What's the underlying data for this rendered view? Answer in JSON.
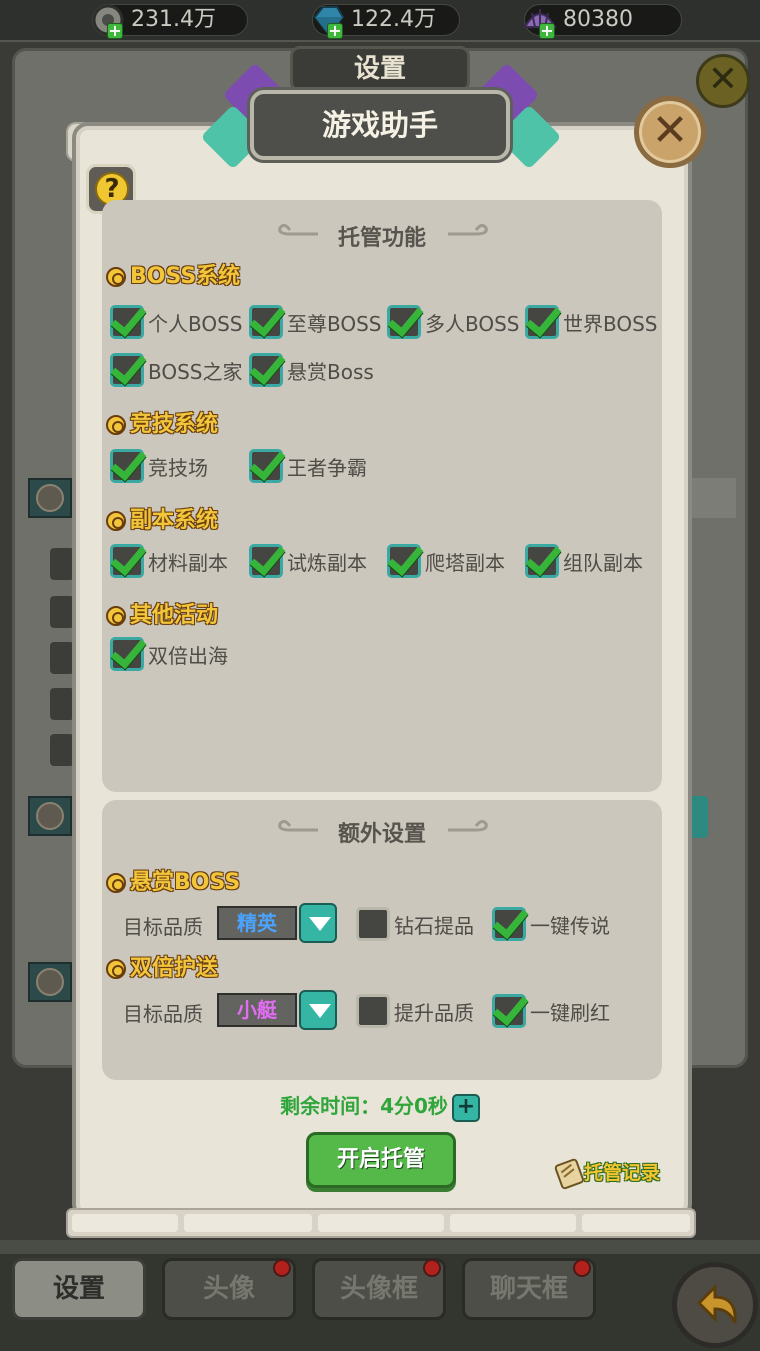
{
  "resources": [
    {
      "value": "231.4万",
      "icon": "coin-icon"
    },
    {
      "value": "122.4万",
      "icon": "gem-icon"
    },
    {
      "value": "80380",
      "icon": "shell-icon"
    }
  ],
  "bg": {
    "title": "设置"
  },
  "dialog": {
    "title": "游戏助手",
    "hosting": {
      "title": "托管功能",
      "categories": [
        {
          "name": "BOSS系统",
          "options": [
            {
              "label": "个人BOSS",
              "checked": true
            },
            {
              "label": "至尊BOSS",
              "checked": true
            },
            {
              "label": "多人BOSS",
              "checked": true
            },
            {
              "label": "世界BOSS",
              "checked": true
            },
            {
              "label": "BOSS之家",
              "checked": true
            },
            {
              "label": "悬赏Boss",
              "checked": true
            }
          ]
        },
        {
          "name": "竞技系统",
          "options": [
            {
              "label": "竞技场",
              "checked": true
            },
            {
              "label": "王者争霸",
              "checked": true
            }
          ]
        },
        {
          "name": "副本系统",
          "options": [
            {
              "label": "材料副本",
              "checked": true
            },
            {
              "label": "试炼副本",
              "checked": true
            },
            {
              "label": "爬塔副本",
              "checked": true
            },
            {
              "label": "组队副本",
              "checked": true
            }
          ]
        },
        {
          "name": "其他活动",
          "options": [
            {
              "label": "双倍出海",
              "checked": true
            }
          ]
        }
      ]
    },
    "extra": {
      "title": "额外设置",
      "bounty": {
        "name": "悬赏BOSS",
        "quality_label": "目标品质",
        "quality_value": "精英",
        "quality_color": "#4aa3ff",
        "opt1": {
          "label": "钻石提品",
          "checked": false
        },
        "opt2": {
          "label": "一键传说",
          "checked": true
        }
      },
      "escort": {
        "name": "双倍护送",
        "quality_label": "目标品质",
        "quality_value": "小艇",
        "quality_color": "#e36cf5",
        "opt1": {
          "label": "提升品质",
          "checked": false
        },
        "opt2": {
          "label": "一键刷红",
          "checked": true
        }
      }
    },
    "remaining_label": "剩余时间：",
    "remaining_value": "4分0秒",
    "remaining_plus": "+",
    "start_button": "开启托管",
    "record_link": "托管记录",
    "help": "?",
    "close": "✕"
  },
  "tabs": [
    {
      "label": "设置",
      "active": true,
      "dot": false
    },
    {
      "label": "头像",
      "active": false,
      "dot": true
    },
    {
      "label": "头像框",
      "active": false,
      "dot": true
    },
    {
      "label": "聊天框",
      "active": false,
      "dot": true
    }
  ]
}
